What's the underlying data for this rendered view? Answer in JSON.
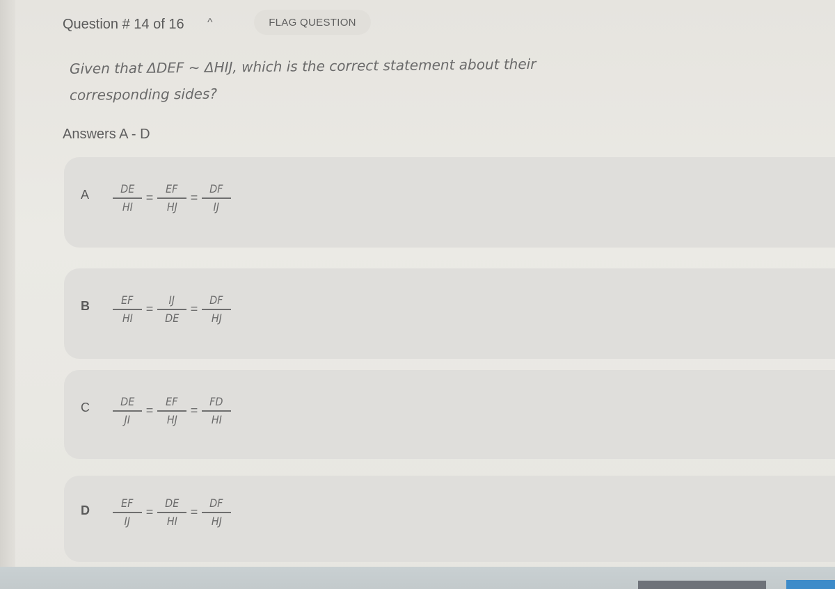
{
  "header": {
    "question_counter": "Question # 14 of 16",
    "collapse_icon": "chevron-up-icon",
    "collapse_glyph": "^",
    "flag_button_label": "FLAG QUESTION"
  },
  "question": {
    "text": "Given that ΔDEF ~ ΔHIJ, which is the correct statement about their corresponding sides?"
  },
  "answers_label": "Answers A - D",
  "options": [
    {
      "letter": "A",
      "fractions": [
        {
          "num": "DE",
          "den": "HI"
        },
        {
          "num": "EF",
          "den": "HJ"
        },
        {
          "num": "DF",
          "den": "IJ"
        }
      ]
    },
    {
      "letter": "B",
      "fractions": [
        {
          "num": "EF",
          "den": "HI"
        },
        {
          "num": "IJ",
          "den": "DE"
        },
        {
          "num": "DF",
          "den": "HJ"
        }
      ]
    },
    {
      "letter": "C",
      "fractions": [
        {
          "num": "DE",
          "den": "JI"
        },
        {
          "num": "EF",
          "den": "HJ"
        },
        {
          "num": "FD",
          "den": "HI"
        }
      ]
    },
    {
      "letter": "D",
      "fractions": [
        {
          "num": "EF",
          "den": "IJ"
        },
        {
          "num": "DE",
          "den": "HI"
        },
        {
          "num": "DF",
          "den": "HJ"
        }
      ]
    }
  ],
  "equals_sign": "=",
  "colors": {
    "background": "#e9e8e3",
    "option_background": "#dfdedb",
    "text": "#5d5d5d",
    "taskbar": "#c6cdcf",
    "taskbar_gray_button": "#6e7279",
    "taskbar_blue_button": "#3d8bc9"
  }
}
